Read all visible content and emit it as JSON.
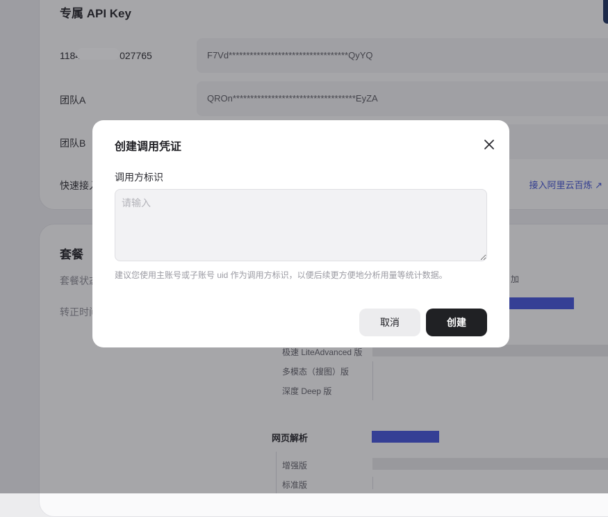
{
  "background": {
    "api_section": {
      "title": "专属 API Key",
      "rows": [
        {
          "label_prefix": "1184",
          "label_suffix": "027765",
          "key": "F7Vd**********************************QyYQ"
        },
        {
          "label": "团队A",
          "key": "QROn***********************************EyZA"
        },
        {
          "label": "团队B",
          "key": ""
        }
      ],
      "quick_access_label": "快速接入",
      "quick_access_link": "接入阿里云百炼 ↗"
    },
    "plan_section": {
      "title": "套餐",
      "status_label": "套餐状态",
      "convert_time_label": "转正时间",
      "trailing_text": "加",
      "search_items": [
        "极速 LiteAdvanced 版",
        "多模态（搜图）版",
        "深度 Deep 版"
      ],
      "web_parse": {
        "title": "网页解析",
        "items": [
          "增强版",
          "标准版"
        ]
      }
    }
  },
  "modal": {
    "title": "创建调用凭证",
    "field_label": "调用方标识",
    "placeholder": "请输入",
    "hint": "建议您使用主账号或子账号 uid 作为调用方标识，以便后续更方便地分析用量等统计数据。",
    "cancel_label": "取消",
    "create_label": "创建",
    "close_icon": "close-icon"
  },
  "colors": {
    "accent_blue": "#3f4fd9",
    "primary_button": "#202124"
  }
}
